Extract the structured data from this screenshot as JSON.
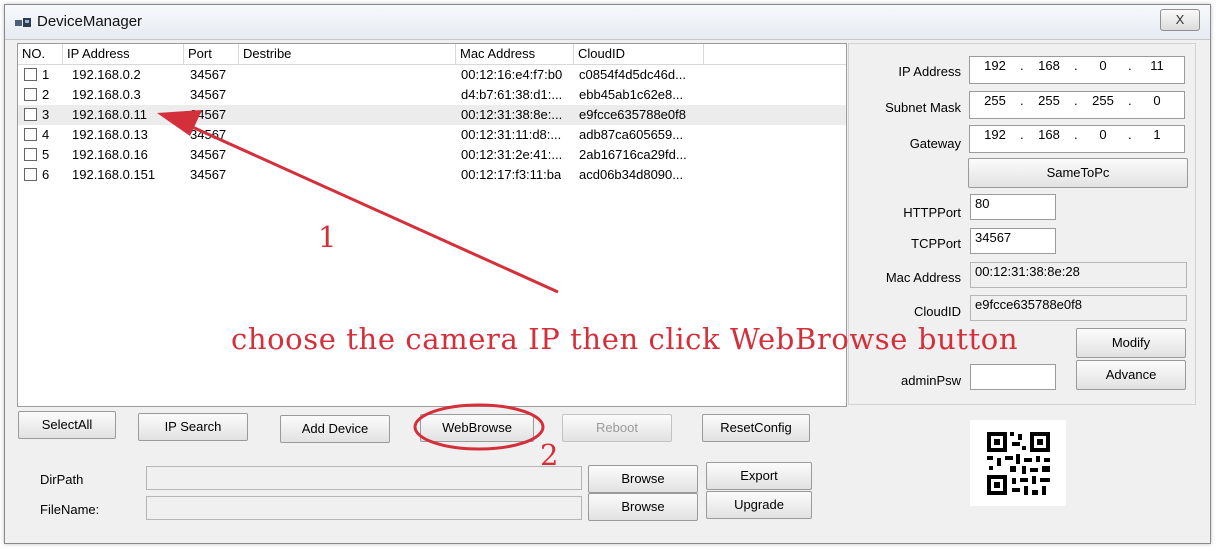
{
  "window": {
    "title": "DeviceManager",
    "close_label": "X"
  },
  "columns": [
    "NO.",
    "IP Address",
    "Port",
    "Destribe",
    "Mac Address",
    "CloudID"
  ],
  "devices": [
    {
      "no": "1",
      "ip": "192.168.0.2",
      "port": "34567",
      "desc": "",
      "mac": "00:12:16:e4:f7:b0",
      "cloud": "c0854f4d5dc46d..."
    },
    {
      "no": "2",
      "ip": "192.168.0.3",
      "port": "34567",
      "desc": "",
      "mac": "d4:b7:61:38:d1:...",
      "cloud": "ebb45ab1c62e8..."
    },
    {
      "no": "3",
      "ip": "192.168.0.11",
      "port": "34567",
      "desc": "",
      "mac": "00:12:31:38:8e:...",
      "cloud": "e9fcce635788e0f8"
    },
    {
      "no": "4",
      "ip": "192.168.0.13",
      "port": "34567",
      "desc": "",
      "mac": "00:12:31:11:d8:...",
      "cloud": "adb87ca605659..."
    },
    {
      "no": "5",
      "ip": "192.168.0.16",
      "port": "34567",
      "desc": "",
      "mac": "00:12:31:2e:41:...",
      "cloud": "2ab16716ca29fd..."
    },
    {
      "no": "6",
      "ip": "192.168.0.151",
      "port": "34567",
      "desc": "",
      "mac": "00:12:17:f3:11:ba",
      "cloud": "acd06b34d8090..."
    }
  ],
  "selected_row": 2,
  "config": {
    "ip_label": "IP Address",
    "ip": [
      "192",
      "168",
      "0",
      "11"
    ],
    "mask_label": "Subnet Mask",
    "mask": [
      "255",
      "255",
      "255",
      "0"
    ],
    "gateway_label": "Gateway",
    "gateway": [
      "192",
      "168",
      "0",
      "1"
    ],
    "same_to_pc": "SameToPc",
    "http_label": "HTTPPort",
    "http": "80",
    "tcp_label": "TCPPort",
    "tcp": "34567",
    "mac_label": "Mac Address",
    "mac": "00:12:31:38:8e:28",
    "cloud_label": "CloudID",
    "cloud": "e9fcce635788e0f8",
    "modify": "Modify",
    "admin_label": "adminPsw",
    "admin": "",
    "advance": "Advance"
  },
  "buttons": {
    "select_all": "SelectAll",
    "ip_search": "IP Search",
    "add_device": "Add Device",
    "web_browse": "WebBrowse",
    "reboot": "Reboot",
    "reset_config": "ResetConfig",
    "browse1": "Browse",
    "export": "Export",
    "browse2": "Browse",
    "upgrade": "Upgrade"
  },
  "files": {
    "dir_label": "DirPath",
    "dir": "",
    "file_label": "FileName:",
    "file": ""
  },
  "annotation": {
    "text": "choose the camera IP then click WebBrowse button",
    "step1": "1",
    "step2": "2",
    "color": "#d4303b"
  }
}
